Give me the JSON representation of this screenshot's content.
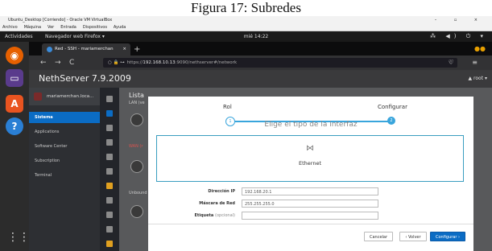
{
  "caption": "Figura 17: Subredes",
  "vm_window": {
    "title": "Ubuntu_Desktop [Corriendo] - Oracle VM VirtualBox",
    "controls": "– ▫ ×",
    "menu": [
      "Archivo",
      "Máquina",
      "Ver",
      "Entrada",
      "Dispositivos",
      "Ayuda"
    ]
  },
  "topbar": {
    "activities": "Actividades",
    "app_menu": "Navegador web Firefox ▾",
    "clock": "mié 14:22",
    "sys_icons": "⁂ ◀) ⏻ ▾"
  },
  "browser": {
    "tab_label": "Red - SSH - mariamerchan",
    "tab_close": "×",
    "new_tab": "+",
    "url_prefix": "https://",
    "url_host": "192.168.10.13",
    "url_path": ":9090/nethserver#/network",
    "back": "←",
    "forward": "→",
    "reload": "C",
    "bookmark": "☆",
    "right_icons": "♡ ≡"
  },
  "nethserver": {
    "brand": "NethServer 7.9.2009",
    "user": "▲ root ▾",
    "host": "mariamerchan.loca...",
    "nav": [
      "Sistema",
      "Applications",
      "Software Center",
      "Subscription",
      "Terminal"
    ],
    "lista": "Lista",
    "lan_label": "LAN (ve",
    "wan_label": "WAN (r",
    "unbound_label": "Unbound"
  },
  "modal": {
    "step1_label": "Rol",
    "step2_label": "Configurar",
    "step1_num": "1",
    "step2_num": "2",
    "heading": "Elige el tipo de la interfaz",
    "ethernet_symbol": "⋈",
    "ethernet_label": "Ethernet",
    "fields": [
      {
        "label": "Dirección IP",
        "value": "192.168.20.1",
        "optional": ""
      },
      {
        "label": "Máscara de Red",
        "value": "255.255.255.0",
        "optional": ""
      },
      {
        "label": "Etiqueta",
        "value": "",
        "optional": "(opcional)"
      }
    ],
    "btn_cancel": "Cancelar",
    "btn_back": "‹ Volver",
    "btn_next": "Configurar ›"
  }
}
